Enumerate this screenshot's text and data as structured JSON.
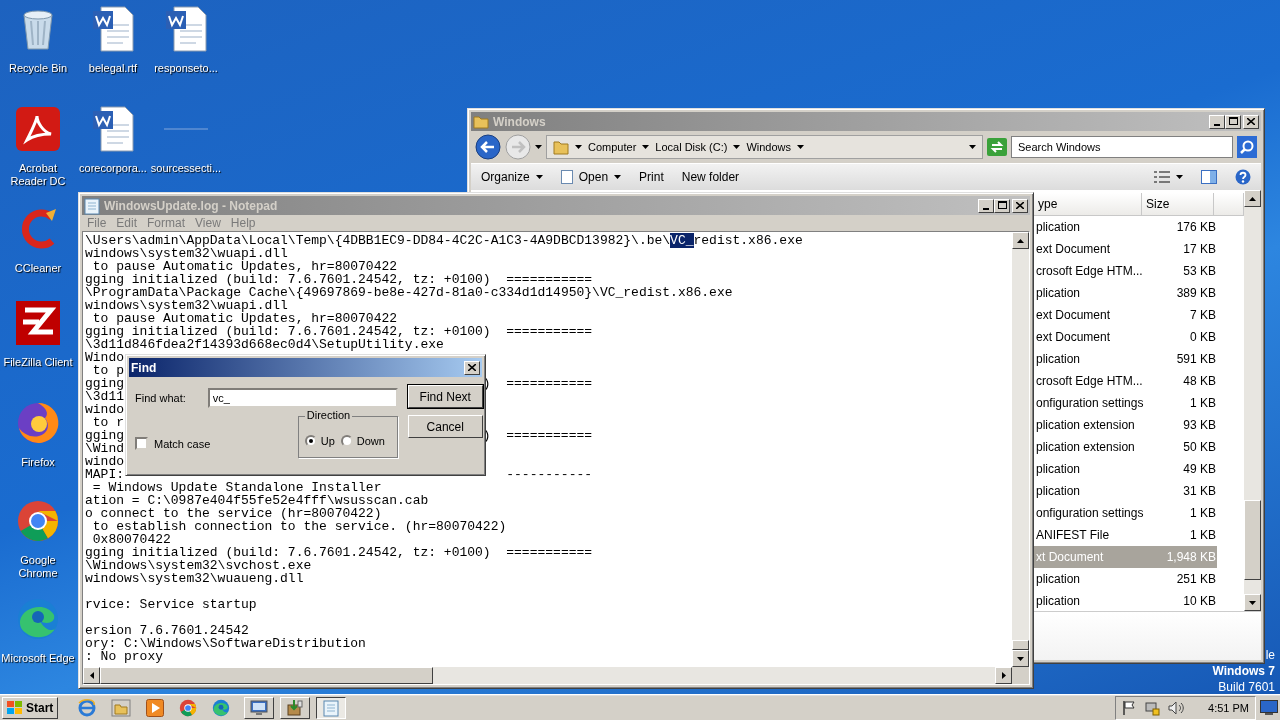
{
  "desktop_icons": [
    {
      "label": "Recycle Bin",
      "kind": "recycle-bin"
    },
    {
      "label": "belegal.rtf",
      "kind": "document"
    },
    {
      "label": "responseto...",
      "kind": "document"
    },
    {
      "label": "Acrobat Reader DC",
      "kind": "pdf-reader"
    },
    {
      "label": "corecorpora...",
      "kind": "document"
    },
    {
      "label": "sourcessecti...",
      "kind": "blank-file"
    },
    {
      "label": "CCleaner",
      "kind": "cleaner"
    },
    {
      "label": "FileZilla Client",
      "kind": "ftp-client"
    },
    {
      "label": "Firefox",
      "kind": "fox-browser"
    },
    {
      "label": "Google Chrome",
      "kind": "chrome-browser"
    },
    {
      "label": "Microsoft Edge",
      "kind": "edge-browser"
    }
  ],
  "desktop_text": [
    "le",
    "Windows 7",
    "Build 7601"
  ],
  "explorer": {
    "title": "Windows",
    "breadcrumb": [
      "Computer",
      "Local Disk (C:)",
      "Windows"
    ],
    "search": {
      "placeholder": "Search Windows"
    },
    "toolbar": [
      {
        "label": "Organize",
        "menu": true
      },
      {
        "label": "Open",
        "menu": true
      },
      {
        "label": "Print",
        "menu": false
      },
      {
        "label": "New folder",
        "menu": false
      }
    ],
    "columns": [
      "ype",
      "Size"
    ],
    "rows": [
      {
        "type": "plication",
        "size": "176 KB",
        "selected": false
      },
      {
        "type": "ext Document",
        "size": "17 KB",
        "selected": false
      },
      {
        "type": "crosoft Edge HTM...",
        "size": "53 KB",
        "selected": false
      },
      {
        "type": "plication",
        "size": "389 KB",
        "selected": false
      },
      {
        "type": "ext Document",
        "size": "7 KB",
        "selected": false
      },
      {
        "type": "ext Document",
        "size": "0 KB",
        "selected": false
      },
      {
        "type": "plication",
        "size": "591 KB",
        "selected": false
      },
      {
        "type": "crosoft Edge HTM...",
        "size": "48 KB",
        "selected": false
      },
      {
        "type": "onfiguration settings",
        "size": "1 KB",
        "selected": false
      },
      {
        "type": "plication extension",
        "size": "93 KB",
        "selected": false
      },
      {
        "type": "plication extension",
        "size": "50 KB",
        "selected": false
      },
      {
        "type": "plication",
        "size": "49 KB",
        "selected": false
      },
      {
        "type": "plication",
        "size": "31 KB",
        "selected": false
      },
      {
        "type": "onfiguration settings",
        "size": "1 KB",
        "selected": false
      },
      {
        "type": "ANIFEST File",
        "size": "1 KB",
        "selected": false
      },
      {
        "type": "xt Document",
        "size": "1,948 KB",
        "selected": true
      },
      {
        "type": "plication",
        "size": "251 KB",
        "selected": false
      },
      {
        "type": "plication",
        "size": "10 KB",
        "selected": false
      }
    ]
  },
  "notepad": {
    "title": "WindowsUpdate.log - Notepad",
    "menu": [
      "File",
      "Edit",
      "Format",
      "View",
      "Help"
    ],
    "lines": [
      {
        "segments": [
          {
            "text": "\\Users\\admin\\AppData\\Local\\Temp\\{4DBB1EC9-DD84-4C2C-A1C3-4A9DBCD13982}\\.be\\",
            "selected": false
          },
          {
            "text": "VC_",
            "selected": true
          },
          {
            "text": "redist.x86.exe",
            "selected": false
          }
        ]
      },
      {
        "text": "windows\\system32\\wuapi.dll"
      },
      {
        "text": " to pause Automatic Updates, hr=80070422"
      },
      {
        "text": "gging initialized (build: 7.6.7601.24542, tz: +0100)  ==========="
      },
      {
        "text": "\\ProgramData\\Package Cache\\{49697869-be8e-427d-81a0-c334d1d14950}\\VC_redist.x86.exe"
      },
      {
        "text": "windows\\system32\\wuapi.dll"
      },
      {
        "text": " to pause Automatic Updates, hr=80070422"
      },
      {
        "text": "gging initialized (build: 7.6.7601.24542, tz: +0100)  ==========="
      },
      {
        "text": "\\3d11d846fdea2f14393d668ec0d4\\SetupUtility.exe"
      },
      {
        "text": "Windo"
      },
      {
        "text": " to p"
      },
      {
        "text": "gging",
        "tail": ")  ==========="
      },
      {
        "text": "\\3d11"
      },
      {
        "text": "windo"
      },
      {
        "text": " to r"
      },
      {
        "text": "gging",
        "tail": ")  ==========="
      },
      {
        "text": "\\Wind"
      },
      {
        "text": "windo"
      },
      {
        "text": "MAPI:",
        "tail": "-----------"
      },
      {
        "text": " = Windows Update Standalone Installer"
      },
      {
        "text": "ation = C:\\0987e404f55fe52e4fff\\wsusscan.cab"
      },
      {
        "text": "o connect to the service (hr=80070422)"
      },
      {
        "text": " to establish connection to the service. (hr=80070422)"
      },
      {
        "text": " 0x80070422"
      },
      {
        "text": "gging initialized (build: 7.6.7601.24542, tz: +0100)  ==========="
      },
      {
        "text": "\\Windows\\system32\\svchost.exe"
      },
      {
        "text": "windows\\system32\\wuaueng.dll"
      },
      {
        "blank": true
      },
      {
        "text": "rvice: Service startup"
      },
      {
        "blank": true
      },
      {
        "text": "ersion 7.6.7601.24542"
      },
      {
        "text": "ory: C:\\Windows\\SoftwareDistribution"
      },
      {
        "text": ": No proxy"
      }
    ]
  },
  "find": {
    "title": "Find",
    "find_what_label": "Find what:",
    "value": "vc_",
    "buttons": [
      "Find Next",
      "Cancel"
    ],
    "direction": {
      "label": "Direction",
      "options": [
        {
          "label": "Up",
          "selected": true
        },
        {
          "label": "Down",
          "selected": false
        }
      ]
    },
    "match_case": {
      "label": "Match case",
      "checked": false
    }
  },
  "taskbar": {
    "start": "Start",
    "tasks": [
      {
        "selected": false
      },
      {
        "selected": false
      },
      {
        "selected": true
      }
    ],
    "clock": "4:51 PM"
  }
}
